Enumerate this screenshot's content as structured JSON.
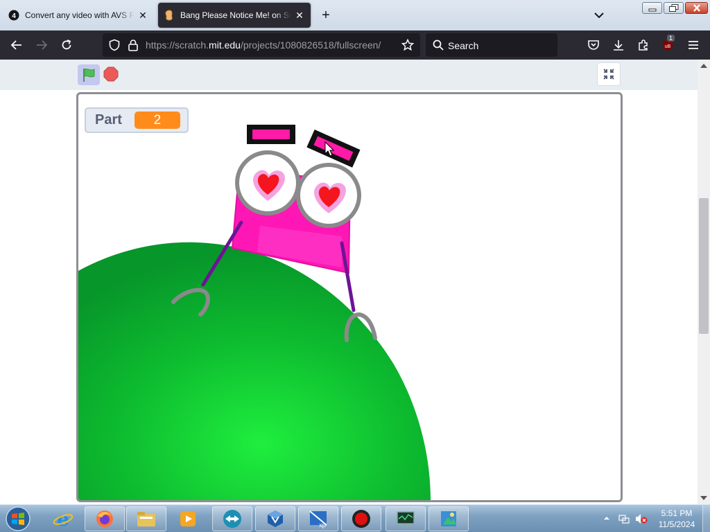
{
  "browser": {
    "tabs": [
      {
        "title": "Convert any video with AVS Free Video Converter",
        "badge": "4",
        "active": false
      },
      {
        "title": "Bang Please Notice Me! on Scratch",
        "active": true
      }
    ],
    "new_tab_label": "+",
    "url": {
      "prefix": "https://scratch.",
      "host": "mit.edu",
      "path": "/projects/1080826518/fullscreen/"
    },
    "search_placeholder": "Search",
    "extensions_badge": "1"
  },
  "scratch": {
    "monitor": {
      "label": "Part",
      "value": "2"
    },
    "colors": {
      "flag": "#4cbf56",
      "stop": "#ec5959",
      "monitor_value_bg": "#ff8c1a",
      "planet": "#0aa12a"
    }
  },
  "taskbar": {
    "time": "5:51 PM",
    "date": "11/5/2024",
    "pinned": [
      "internet-explorer-icon",
      "firefox-icon",
      "file-explorer-icon",
      "media-player-icon",
      "teamviewer-icon",
      "virtualbox-icon",
      "xp-mode-icon",
      "screen-recorder-icon",
      "system-monitor-icon",
      "image-tool-icon"
    ]
  }
}
